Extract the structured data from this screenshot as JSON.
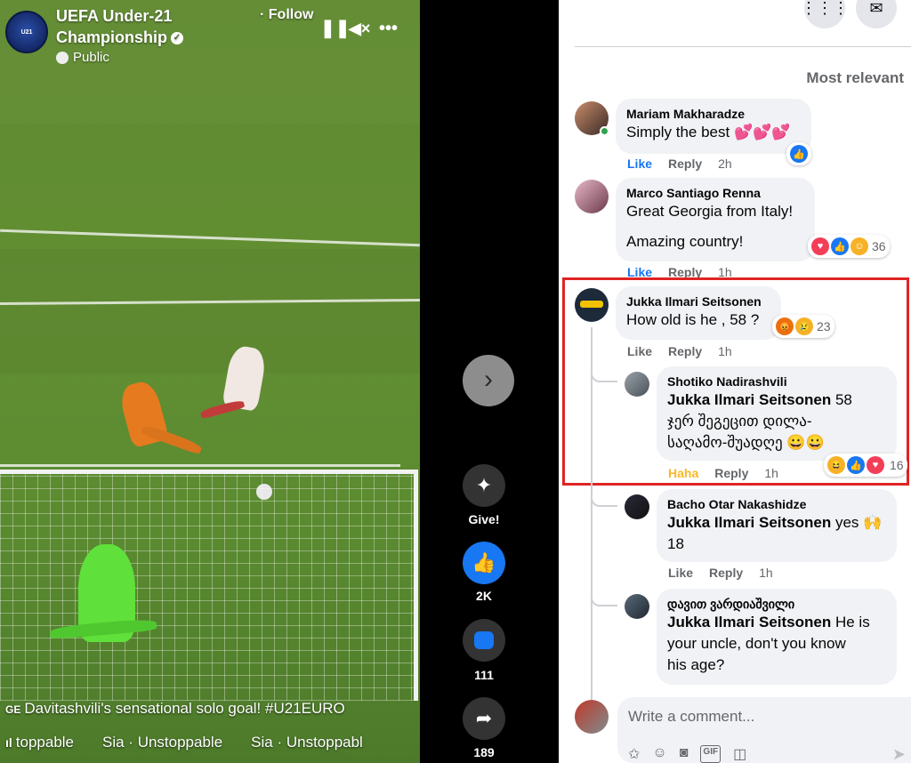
{
  "video": {
    "channel_name": "UEFA Under-21 Championship",
    "visibility": "Public",
    "follow_label": "· Follow",
    "caption_lang": "GE",
    "caption": "Davitashvili's sensational solo goal! #U21EURO",
    "music_items": [
      "toppable",
      "Sia · Unstoppable",
      "Sia · Unstoppabl"
    ]
  },
  "actions": {
    "give_label": "Give!",
    "likes": "2K",
    "comments": "111",
    "shares": "189"
  },
  "panel": {
    "sort_label": "Most relevant",
    "composer_placeholder": "Write a comment..."
  },
  "comments": [
    {
      "author": "Mariam Makharadze",
      "text": "Simply the best 💕💕💕",
      "like": "Like",
      "reply": "Reply",
      "time": "2h"
    },
    {
      "author": "Marco Santiago Renna",
      "text_lines": [
        "Great Georgia from Italy!",
        "Amazing country!"
      ],
      "reaction_count": "36",
      "like": "Like",
      "reply": "Reply",
      "time": "1h"
    },
    {
      "author": "Jukka Ilmari Seitsonen",
      "text": "How old is he , 58 ?",
      "reaction_count": "23",
      "like": "Like",
      "reply": "Reply",
      "time": "1h"
    }
  ],
  "replies": [
    {
      "author": "Shotiko Nadirashvili",
      "tag": "Jukka Ilmari Seitsonen",
      "text_rest": " 58",
      "text_lines": [
        "ჯერ შეგეცით დილა-",
        "საღამო-შუადღე 😀😀"
      ],
      "reaction_count": "16",
      "like": "Haha",
      "reply": "Reply",
      "time": "1h"
    },
    {
      "author": "Bacho Otar Nakashidze",
      "tag": "Jukka Ilmari Seitsonen",
      "text_rest": " yes 🙌",
      "text_line2": "18",
      "like": "Like",
      "reply": "Reply",
      "time": "1h"
    },
    {
      "author": "დავით ვარდიაშვილი",
      "tag": "Jukka Ilmari Seitsonen",
      "text_rest": " He is",
      "text_lines": [
        "your uncle, don't you know",
        "his age?"
      ]
    }
  ]
}
